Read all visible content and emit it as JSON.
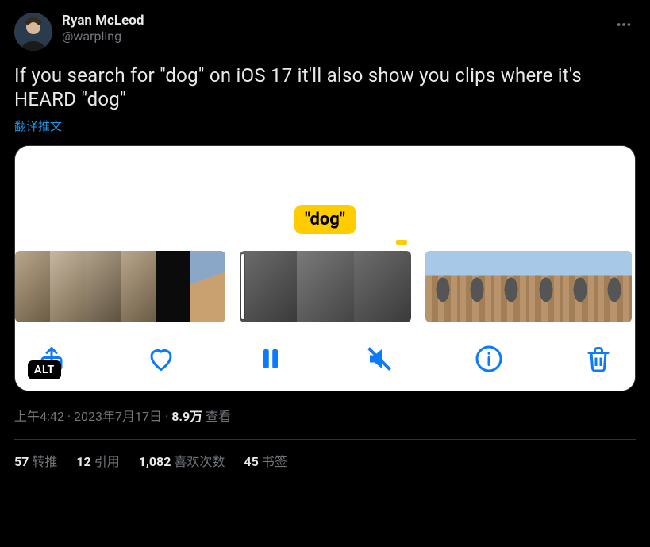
{
  "author": {
    "display_name": "Ryan McLeod",
    "handle": "@warpling"
  },
  "tweet_text": "If you search for \"dog\" on iOS 17 it'll also show you clips where it's HEARD \"dog\"",
  "translate_label": "翻译推文",
  "media": {
    "tooltip": "\"dog\"",
    "alt_badge": "ALT"
  },
  "meta": {
    "time": "上午4:42",
    "date": "2023年7月17日",
    "views_number": "8.9万",
    "views_label": "查看"
  },
  "stats": {
    "retweets": {
      "count": "57",
      "label": "转推"
    },
    "quotes": {
      "count": "12",
      "label": "引用"
    },
    "likes": {
      "count": "1,082",
      "label": "喜欢次数"
    },
    "bookmarks": {
      "count": "45",
      "label": "书签"
    }
  },
  "icons": {
    "more": "more-icon",
    "share": "share-icon",
    "heart": "heart-icon",
    "pause": "pause-icon",
    "mute": "mute-icon",
    "info": "info-icon",
    "trash": "trash-icon"
  }
}
